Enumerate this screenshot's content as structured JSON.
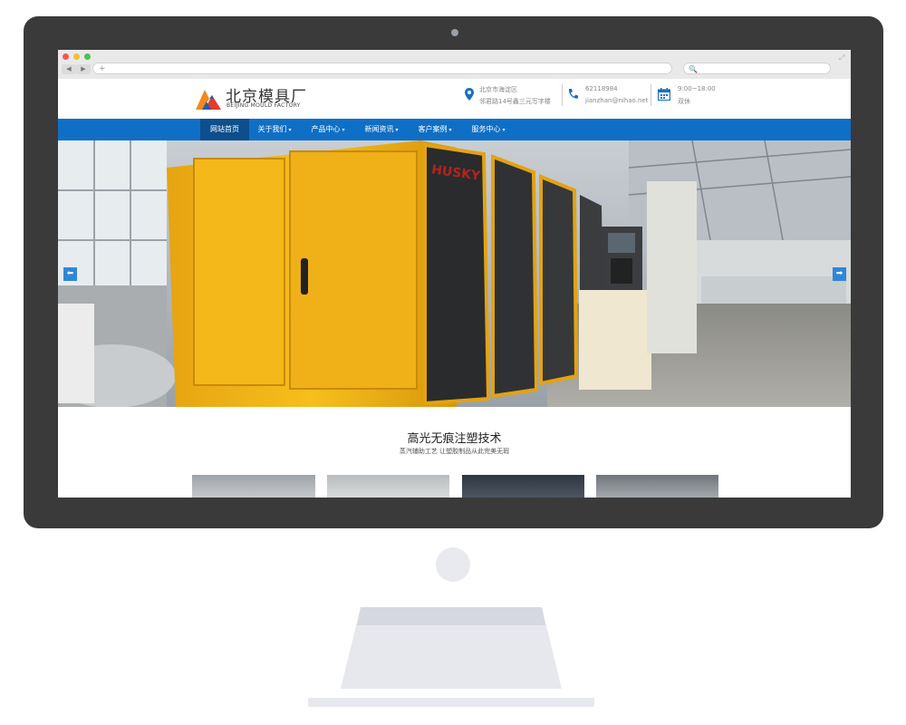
{
  "browser": {
    "back_label": "◀",
    "forward_label": "▶",
    "address_value": "+",
    "search_placeholder": "🔍"
  },
  "header": {
    "logo_cn": "北京模具厂",
    "logo_en": "BEIJING MOULD FACTORY",
    "address_line1": "北京市海淀区",
    "address_line2": "邻君路14号鑫三元写字楼",
    "phone": "62118984",
    "email": "jianzhan@nihao.net",
    "hours": "9:00~18:00",
    "days": "双休",
    "icons": [
      "map-pin-icon",
      "phone-icon",
      "calendar-icon"
    ]
  },
  "nav": {
    "items": [
      {
        "label": "网站首页",
        "dropdown": false
      },
      {
        "label": "关于我们",
        "dropdown": true
      },
      {
        "label": "产品中心",
        "dropdown": true
      },
      {
        "label": "新闻资讯",
        "dropdown": true
      },
      {
        "label": "客户案例",
        "dropdown": true
      },
      {
        "label": "服务中心",
        "dropdown": true
      }
    ],
    "caret": "▾"
  },
  "banner": {
    "machine_brand": "HUSKY",
    "prev_label": "⬅",
    "next_label": "➡"
  },
  "section": {
    "title": "高光无痕注塑技术",
    "subtitle": "蒸汽辅助工艺 让塑胶制品从此完美无瑕"
  },
  "colors": {
    "nav_bg": "#0f6fc6",
    "nav_active": "#0c4e8e",
    "accent": "#2f87d9",
    "monitor": "#3a3a3a"
  }
}
